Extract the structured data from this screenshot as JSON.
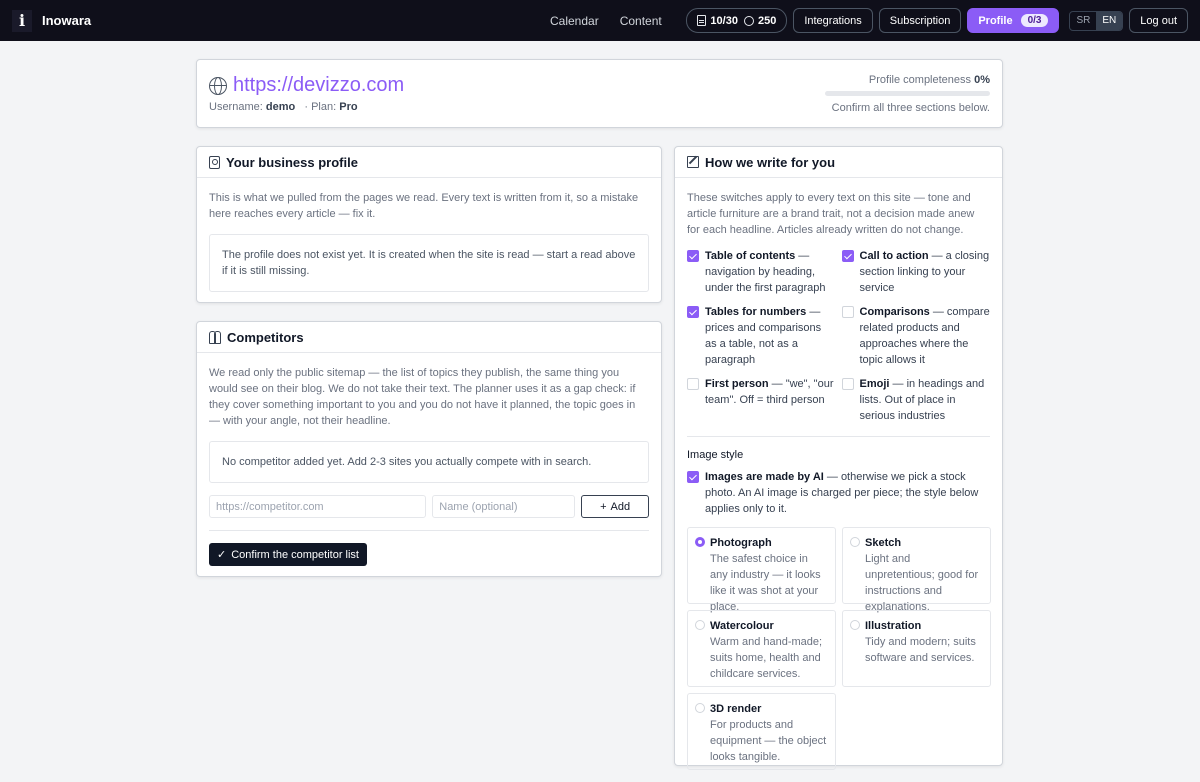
{
  "app": {
    "name": "Inowara",
    "logo_letter": "i"
  },
  "nav": {
    "calendar": "Calendar",
    "content": "Content"
  },
  "quota": {
    "articles": "10/30",
    "credits": "250"
  },
  "header_buttons": {
    "integrations": "Integrations",
    "subscription": "Subscription",
    "profile": "Profile",
    "profile_badge": "0/3",
    "logout": "Log out"
  },
  "languages": [
    {
      "code": "SR",
      "active": false
    },
    {
      "code": "EN",
      "active": true
    }
  ],
  "site": {
    "url": "https://devizzo.com",
    "username_label": "Username:",
    "username": "demo",
    "plan_label": "· Plan:",
    "plan": "Pro",
    "completeness_label": "Profile completeness",
    "completeness_value": "0%",
    "completeness_fraction": 0,
    "completeness_hint": "Confirm all three sections below."
  },
  "business": {
    "title": "Your business profile",
    "intro": "This is what we pulled from the pages we read. Every text is written from it, so a mistake here reaches every article — fix it.",
    "notice": "The profile does not exist yet. It is created when the site is read — start a read above if it is still missing."
  },
  "competitors": {
    "title": "Competitors",
    "intro": "We read only the public sitemap — the list of topics they publish, the same thing you would see on their blog. We do not take their text. The planner uses it as a gap check: if they cover something important to you and you do not have it planned, the topic goes in — with your angle, not their headline.",
    "notice": "No competitor added yet. Add 2-3 sites you actually compete with in search.",
    "url_placeholder": "https://competitor.com",
    "name_placeholder": "Name (optional)",
    "add_label": "Add",
    "confirm_label": "Confirm the competitor list"
  },
  "writing": {
    "title": "How we write for you",
    "intro": "These switches apply to every text on this site — tone and article furniture are a brand trait, not a decision made anew for each headline. Articles already written do not change.",
    "options": [
      {
        "title": "Table of contents",
        "desc": " — navigation by heading, under the first paragraph",
        "checked": true
      },
      {
        "title": "Call to action",
        "desc": " — a closing section linking to your service",
        "checked": true
      },
      {
        "title": "Tables for numbers",
        "desc": " — prices and comparisons as a table, not as a paragraph",
        "checked": true
      },
      {
        "title": "Comparisons",
        "desc": " — compare related products and approaches where the topic allows it",
        "checked": false
      },
      {
        "title": "First person",
        "desc": " — \"we\", \"our team\". Off = third person",
        "checked": false
      },
      {
        "title": "Emoji",
        "desc": " — in headings and lists. Out of place in serious industries",
        "checked": false
      }
    ],
    "image_style_label": "Image style",
    "ai_images": {
      "title": "Images are made by AI",
      "desc": " — otherwise we pick a stock photo. An AI image is charged per piece; the style below applies only to it.",
      "checked": true
    },
    "styles": [
      {
        "title": "Photograph",
        "desc": "The safest choice in any industry — it looks like it was shot at your place.",
        "selected": true
      },
      {
        "title": "Sketch",
        "desc": "Light and unpretentious; good for instructions and explanations.",
        "selected": false
      },
      {
        "title": "Watercolour",
        "desc": "Warm and hand-made; suits home, health and childcare services.",
        "selected": false
      },
      {
        "title": "Illustration",
        "desc": "Tidy and modern; suits software and services.",
        "selected": false
      },
      {
        "title": "3D render",
        "desc": "For products and equipment — the object looks tangible.",
        "selected": false
      }
    ]
  },
  "colors": {
    "accent": "#8b5cf6",
    "topbar": "#0f0f1a",
    "dark_button": "#111827"
  }
}
